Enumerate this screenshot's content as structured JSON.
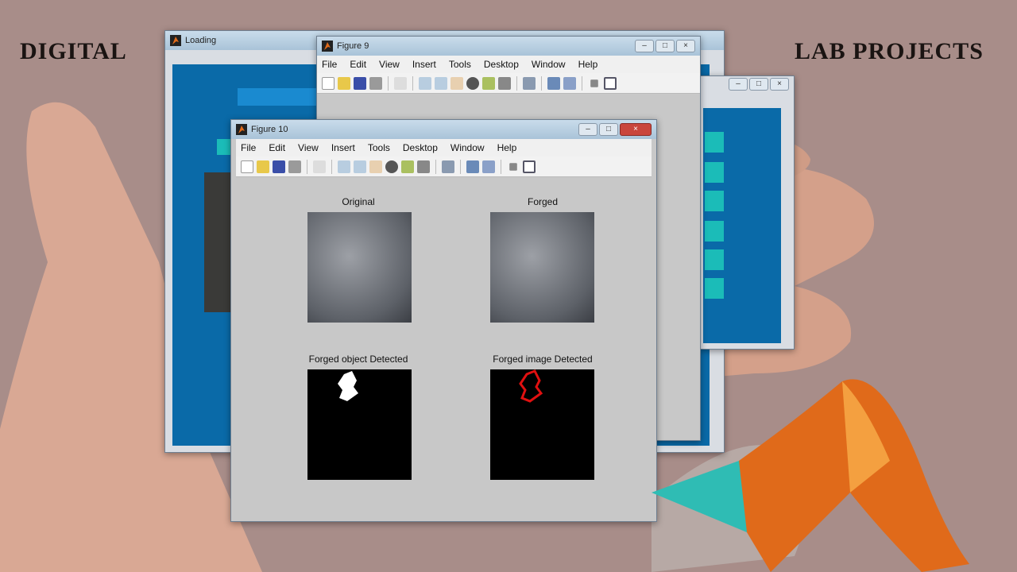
{
  "headline": {
    "left": "DIGITAL",
    "right": "LAB PROJECTS"
  },
  "loading_window": {
    "title": "Loading"
  },
  "figure9": {
    "title": "Figure 9",
    "menu": [
      "File",
      "Edit",
      "View",
      "Insert",
      "Tools",
      "Desktop",
      "Window",
      "Help"
    ]
  },
  "figure10": {
    "title": "Figure 10",
    "menu": [
      "File",
      "Edit",
      "View",
      "Insert",
      "Tools",
      "Desktop",
      "Window",
      "Help"
    ],
    "panels": [
      {
        "label": "Original"
      },
      {
        "label": "Forged"
      },
      {
        "label": "Forged object  Detected"
      },
      {
        "label": "Forged image Detected"
      }
    ]
  },
  "colors": {
    "accent_blue": "#0a6aa8",
    "teal": "#1bbcb8",
    "detected_red": "#e01010"
  }
}
